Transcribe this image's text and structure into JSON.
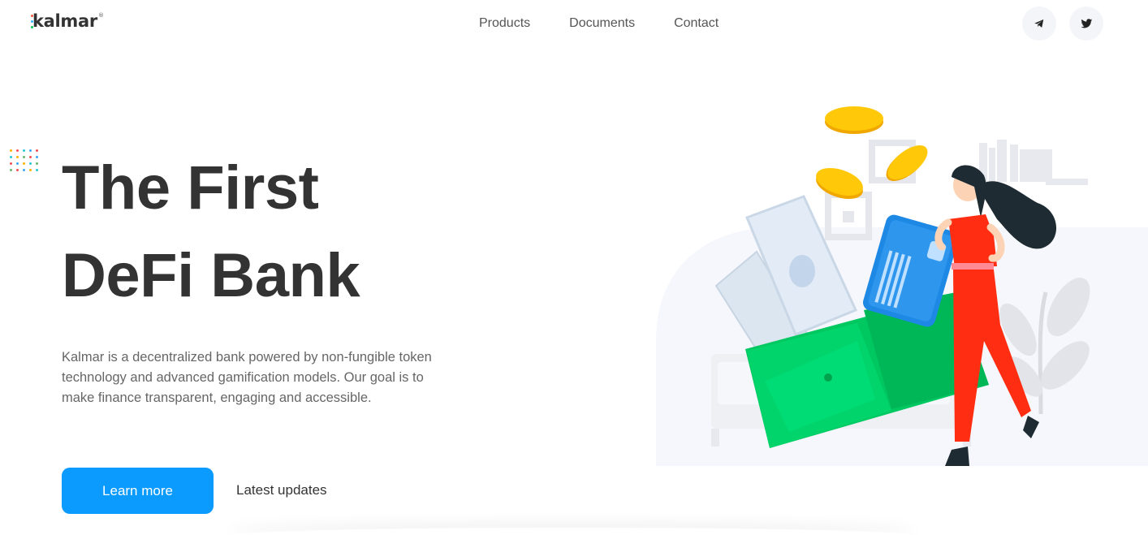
{
  "header": {
    "logo_text": "kalmar",
    "logo_reg": "®",
    "nav": [
      "Products",
      "Documents",
      "Contact"
    ],
    "social": [
      {
        "icon": "telegram-icon"
      },
      {
        "icon": "twitter-icon"
      }
    ]
  },
  "hero": {
    "title_line1": "The First",
    "title_line2": "DeFi Bank",
    "description": "Kalmar is a decentralized bank powered by non-fungible token technology and advanced gamification models. Our goal is to make finance transparent, engaging and accessible.",
    "primary_button": "Learn more",
    "secondary_link": "Latest updates"
  },
  "colors": {
    "accent": "#0b9bff",
    "wallet": "#00d46a",
    "card": "#1e88e5",
    "figure": "#ff2d12",
    "coin": "#ffc107"
  },
  "illustration": {
    "icon": "wallet-woman-illustration"
  }
}
